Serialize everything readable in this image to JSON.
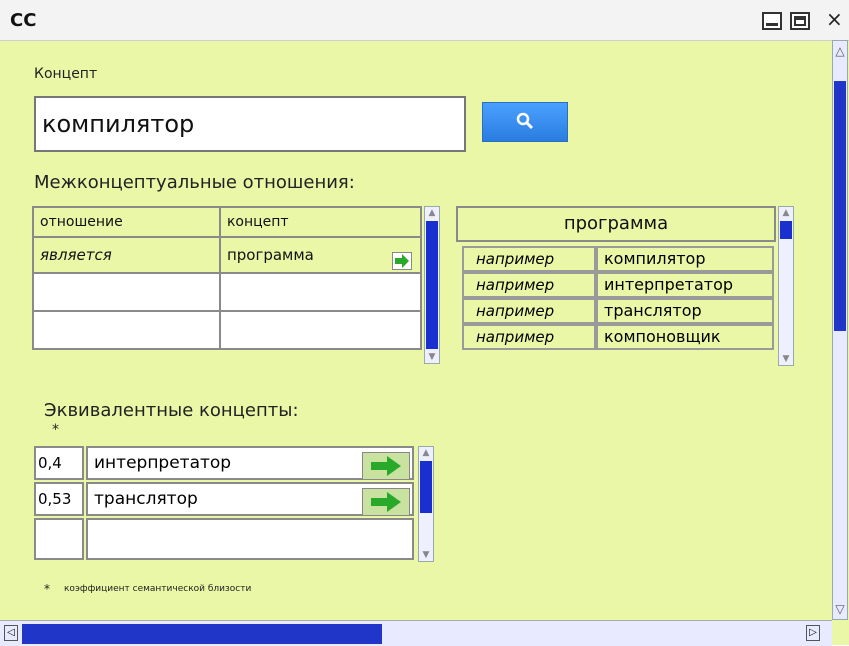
{
  "window": {
    "title": "CC"
  },
  "concept": {
    "label": "Концепт",
    "value": "компилятор"
  },
  "relations": {
    "heading": "Межконцептуальные отношения:",
    "columns": [
      "отношение",
      "концепт"
    ],
    "rows": [
      {
        "relation": "является",
        "concept": "программа"
      },
      {
        "relation": "",
        "concept": ""
      },
      {
        "relation": "",
        "concept": ""
      }
    ]
  },
  "detail": {
    "title": "программа",
    "rows": [
      {
        "relation": "например",
        "concept": "компилятор"
      },
      {
        "relation": "например",
        "concept": "интерпретатор"
      },
      {
        "relation": "например",
        "concept": "транслятор"
      },
      {
        "relation": "например",
        "concept": "компоновщик"
      }
    ]
  },
  "equivalents": {
    "heading": "Эквивалентные концепты:",
    "marker": "*",
    "rows": [
      {
        "coef": "0,4",
        "name": "интерпретатор"
      },
      {
        "coef": "0,53",
        "name": "транслятор"
      },
      {
        "coef": "",
        "name": ""
      }
    ],
    "footnote_marker": "*",
    "footnote": "коэффициент семантической близости"
  },
  "colors": {
    "panel": "#e9f7a6",
    "scroll_thumb": "#1a2fd0",
    "search_button": "#2a7de0",
    "go_arrow": "#29a829"
  },
  "icons": {
    "search": "magnifier-icon",
    "go": "right-arrow-icon"
  }
}
